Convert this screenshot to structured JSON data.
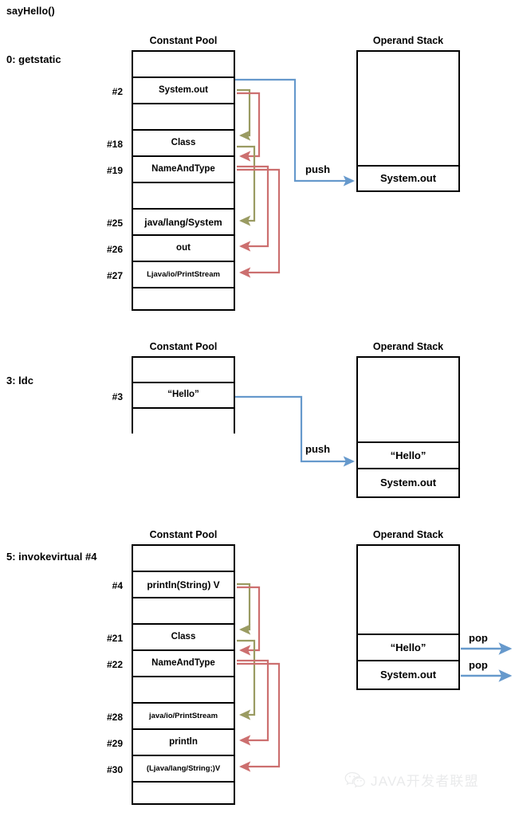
{
  "page": {
    "title": "sayHello()",
    "background": "#ffffff"
  },
  "colors": {
    "stroke": "#000000",
    "push_arrow": "#6699cc",
    "pop_arrow": "#6699cc",
    "ref_arrow_olive": "#9a9b62",
    "ref_arrow_red": "#cc6f6f",
    "watermark": "#b9bcc0"
  },
  "sections": [
    {
      "id": "getstatic",
      "opcode_label": "0: getstatic",
      "constant_pool": {
        "title": "Constant Pool",
        "rows": [
          {
            "index": "",
            "value": ""
          },
          {
            "index": "#2",
            "value": "System.out"
          },
          {
            "index": "",
            "value": ""
          },
          {
            "index": "#18",
            "value": "Class"
          },
          {
            "index": "#19",
            "value": "NameAndType"
          },
          {
            "index": "",
            "value": ""
          },
          {
            "index": "#25",
            "value": "java/lang/System"
          },
          {
            "index": "#26",
            "value": "out"
          },
          {
            "index": "#27",
            "value": "Ljava/io/PrintStream"
          },
          {
            "index": "",
            "value": ""
          }
        ]
      },
      "operand_stack": {
        "title": "Operand Stack",
        "entries": [
          "System.out"
        ]
      },
      "operations": [
        {
          "kind": "push",
          "label": "push",
          "target": "System.out"
        }
      ],
      "references": [
        {
          "from": "#2",
          "to": "#18",
          "color": "olive"
        },
        {
          "from": "#2",
          "to": "#19",
          "color": "red"
        },
        {
          "from": "#19",
          "to": "#25",
          "color": "olive"
        },
        {
          "from": "#19",
          "to": "#26",
          "color": "red"
        },
        {
          "from": "#19",
          "to": "#27",
          "color": "red"
        }
      ]
    },
    {
      "id": "ldc",
      "opcode_label": "3: ldc",
      "constant_pool": {
        "title": "Constant Pool",
        "rows": [
          {
            "index": "",
            "value": ""
          },
          {
            "index": "#3",
            "value": "“Hello”"
          },
          {
            "index": "",
            "value": ""
          }
        ]
      },
      "operand_stack": {
        "title": "Operand Stack",
        "entries": [
          "“Hello”",
          "System.out"
        ]
      },
      "operations": [
        {
          "kind": "push",
          "label": "push",
          "target": "“Hello”"
        }
      ],
      "references": []
    },
    {
      "id": "invokevirtual",
      "opcode_label": "5: invokevirtual #4",
      "constant_pool": {
        "title": "Constant Pool",
        "rows": [
          {
            "index": "",
            "value": ""
          },
          {
            "index": "#4",
            "value": "println(String) V"
          },
          {
            "index": "",
            "value": ""
          },
          {
            "index": "#21",
            "value": "Class"
          },
          {
            "index": "#22",
            "value": "NameAndType"
          },
          {
            "index": "",
            "value": ""
          },
          {
            "index": "#28",
            "value": "java/io/PrintStream"
          },
          {
            "index": "#29",
            "value": "println"
          },
          {
            "index": "#30",
            "value": "(Ljava/lang/String;)V"
          },
          {
            "index": "",
            "value": ""
          }
        ]
      },
      "operand_stack": {
        "title": "Operand Stack",
        "entries": [
          "“Hello”",
          "System.out"
        ]
      },
      "operations": [
        {
          "kind": "pop",
          "label": "pop",
          "target": "“Hello”"
        },
        {
          "kind": "pop",
          "label": "pop",
          "target": "System.out"
        }
      ],
      "references": [
        {
          "from": "#4",
          "to": "#21",
          "color": "olive"
        },
        {
          "from": "#4",
          "to": "#22",
          "color": "red"
        },
        {
          "from": "#22",
          "to": "#28",
          "color": "olive"
        },
        {
          "from": "#22",
          "to": "#29",
          "color": "red"
        },
        {
          "from": "#22",
          "to": "#30",
          "color": "red"
        }
      ]
    }
  ],
  "watermark": {
    "icon": "wechat-icon",
    "text": "JAVA开发者联盟"
  }
}
